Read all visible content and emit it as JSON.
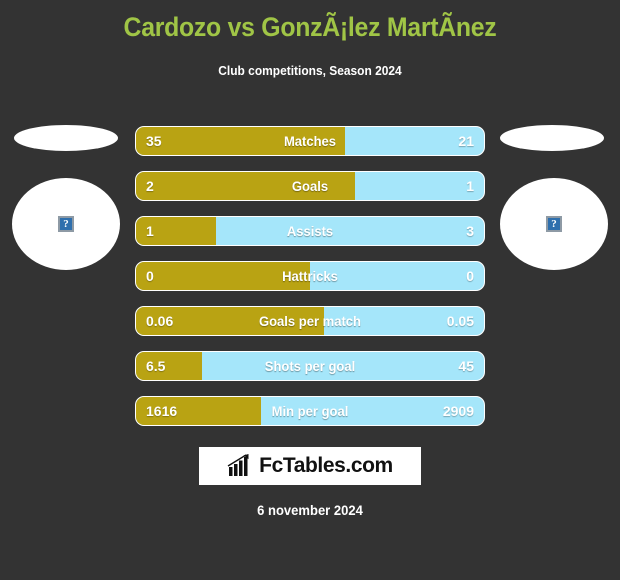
{
  "header": {
    "title": "Cardozo vs GonzÃ¡lez MartÃ­nez",
    "subtitle": "Club competitions, Season 2024"
  },
  "players": {
    "home": {
      "photo_placeholder_icon": "broken-image-icon",
      "placeholder_glyph": "?"
    },
    "away": {
      "photo_placeholder_icon": "broken-image-icon",
      "placeholder_glyph": "?"
    }
  },
  "colors": {
    "background": "#333333",
    "title": "#a0c546",
    "home_bar": "#b9a313",
    "away_bar": "#a5e6fa",
    "text": "#ffffff"
  },
  "footer": {
    "logo_text": "FcTables.com",
    "logo_icon": "bar-chart-arrow-icon",
    "date": "6 november 2024"
  },
  "chart_data": {
    "type": "bar",
    "title": "Cardozo vs GonzÃ¡lez MartÃ­nez",
    "subtitle": "Club competitions, Season 2024",
    "orientation": "horizontal-diverging",
    "series": [
      {
        "name": "Cardozo",
        "color": "#b9a313",
        "values": [
          35,
          2,
          1,
          0,
          0.06,
          6.5,
          1616
        ]
      },
      {
        "name": "GonzÃ¡lez MartÃ­nez",
        "color": "#a5e6fa",
        "values": [
          21,
          1,
          3,
          0,
          0.05,
          45,
          2909
        ]
      }
    ],
    "categories": [
      "Matches",
      "Goals",
      "Assists",
      "Hattricks",
      "Goals per match",
      "Shots per goal",
      "Min per goal"
    ],
    "rows": [
      {
        "label": "Matches",
        "home": "35",
        "away": "21",
        "home_pct": 60
      },
      {
        "label": "Goals",
        "home": "2",
        "away": "1",
        "home_pct": 63
      },
      {
        "label": "Assists",
        "home": "1",
        "away": "3",
        "home_pct": 23
      },
      {
        "label": "Hattricks",
        "home": "0",
        "away": "0",
        "home_pct": 50
      },
      {
        "label": "Goals per match",
        "home": "0.06",
        "away": "0.05",
        "home_pct": 54
      },
      {
        "label": "Shots per goal",
        "home": "6.5",
        "away": "45",
        "home_pct": 19
      },
      {
        "label": "Min per goal",
        "home": "1616",
        "away": "2909",
        "home_pct": 36
      }
    ],
    "xlabel": "",
    "ylabel": "",
    "grid": false,
    "legend": "none"
  }
}
